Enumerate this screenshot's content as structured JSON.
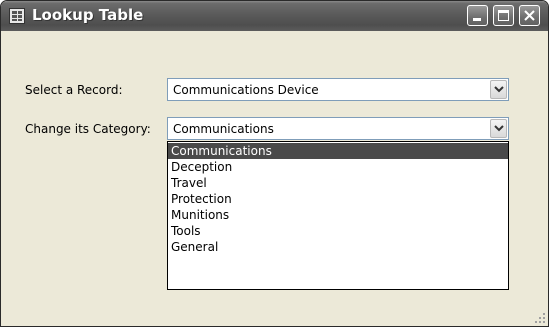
{
  "window": {
    "title": "Lookup Table",
    "controls": [
      "minimize-icon",
      "maximize-icon",
      "close-icon"
    ]
  },
  "form": {
    "record_label": "Select a Record:",
    "record_value": "Communications Device",
    "category_label": "Change its Category:",
    "category_value": "Communications"
  },
  "dropdown": {
    "items": [
      {
        "label": "Communications",
        "selected": true
      },
      {
        "label": "Deception"
      },
      {
        "label": "Travel"
      },
      {
        "label": "Protection"
      },
      {
        "label": "Munitions"
      },
      {
        "label": "Tools"
      },
      {
        "label": "General"
      }
    ]
  },
  "colors": {
    "titlebar": "#5a5a5a",
    "window_bg": "#ece9d8",
    "selection": "#4a4a4a"
  }
}
